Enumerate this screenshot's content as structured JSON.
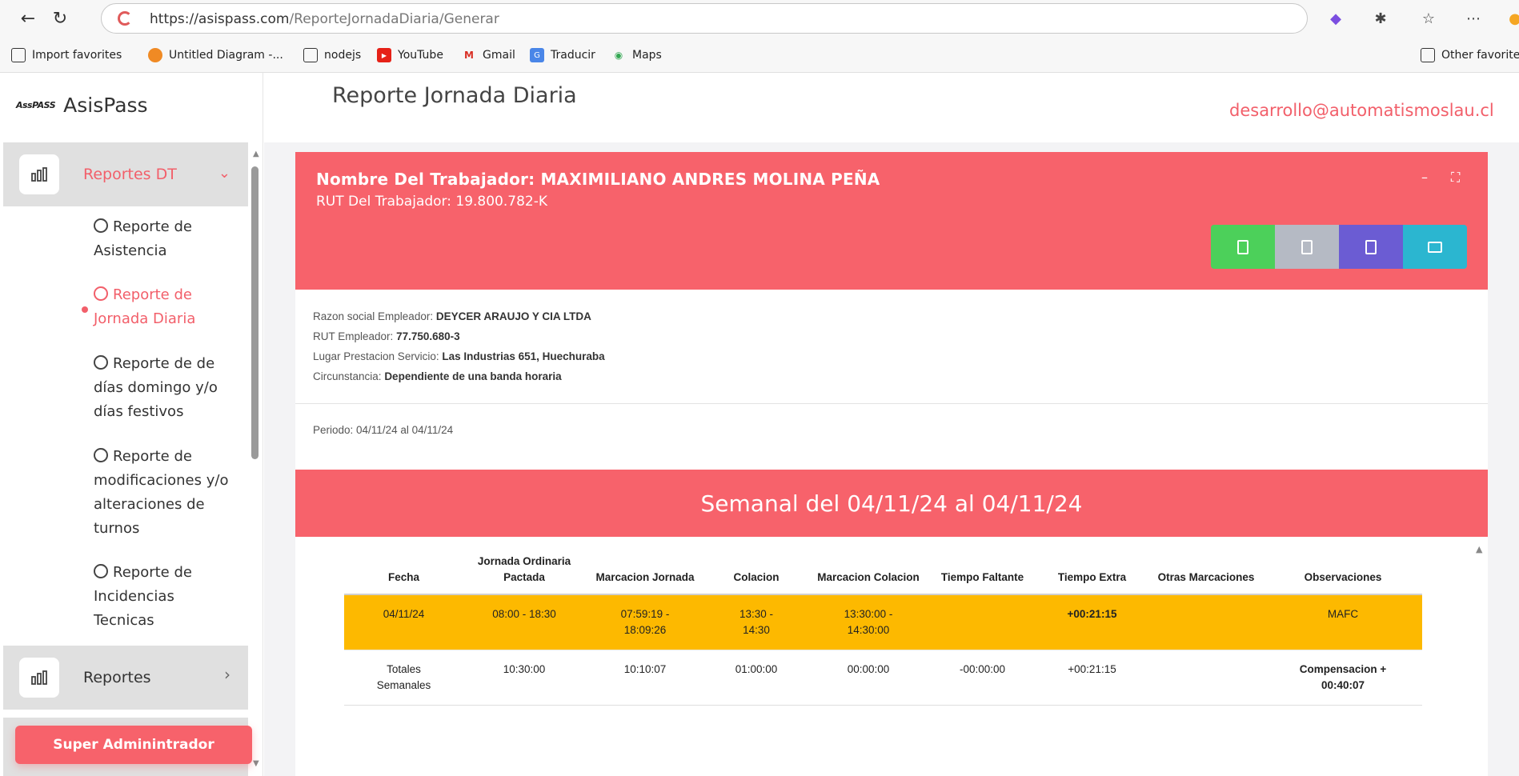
{
  "browser": {
    "url_host": "https://asispass.com",
    "url_path": "/ReporteJornadaDiaria/Generar",
    "bookmarks": [
      "Import favorites",
      "Untitled Diagram -...",
      "nodejs",
      "YouTube",
      "Gmail",
      "Traducir",
      "Maps",
      "Other favorites"
    ]
  },
  "sidebar": {
    "logo_text": "AssPASS",
    "brand": "AsisPass",
    "group1": "Reportes DT",
    "items": [
      {
        "label": "Reporte de Asistencia"
      },
      {
        "label": "Reporte de Jornada Diaria"
      },
      {
        "label": "Reporte de de días domingo y/o días festivos"
      },
      {
        "label": "Reporte de modificaciones y/o alteraciones de turnos"
      },
      {
        "label": "Reporte de Incidencias Tecnicas"
      }
    ],
    "group2": "Reportes",
    "role_button": "Super Admintrador",
    "role_button_full": "Super Adminintrador"
  },
  "header": {
    "title": "Reporte Jornada Diaria",
    "user_email": "desarrollo@automatismoslau.cl"
  },
  "worker": {
    "name_label": "Nombre Del Trabajador: MAXIMILIANO ANDRES MOLINA PEÑA",
    "rut_label": "RUT Del Trabajador: 19.800.782-K"
  },
  "export_buttons": {
    "colors": [
      "#4cd05a",
      "#b5bac4",
      "#6b5cd3",
      "#2bb6d0"
    ],
    "icons": [
      "xls-icon",
      "pdf-icon",
      "document-icon",
      "printer-icon"
    ]
  },
  "employer": {
    "razon_label": "Razon social Empleador:",
    "razon_value": "DEYCER ARAUJO Y CIA LTDA",
    "rut_label": "RUT Empleador:",
    "rut_value": "77.750.680-3",
    "lugar_label": "Lugar Prestacion Servicio:",
    "lugar_value": "Las Industrias 651, Huechuraba",
    "circ_label": "Circunstancia:",
    "circ_value": "Dependiente de una banda horaria"
  },
  "period": "Periodo: 04/11/24 al 04/11/24",
  "week_title": "Semanal del 04/11/24 al 04/11/24",
  "table": {
    "headers": [
      "Fecha",
      "Jornada Ordinaria Pactada",
      "Marcacion Jornada",
      "Colacion",
      "Marcacion Colacion",
      "Tiempo Faltante",
      "Tiempo Extra",
      "Otras Marcaciones",
      "Observaciones"
    ],
    "row": [
      "04/11/24",
      "08:00 - 18:30",
      "07:59:19 - 18:09:26",
      "13:30 - 14:30",
      "13:30:00 - 14:30:00",
      "",
      "+00:21:15",
      "",
      "MAFC"
    ],
    "totals": [
      "Totales Semanales",
      "10:30:00",
      "10:10:07",
      "01:00:00",
      "00:00:00",
      "-00:00:00",
      "+00:21:15",
      "",
      "Compensacion + 00:40:07"
    ]
  },
  "colors": {
    "accent": "#f7626b",
    "highlight_row": "#fdb900"
  }
}
